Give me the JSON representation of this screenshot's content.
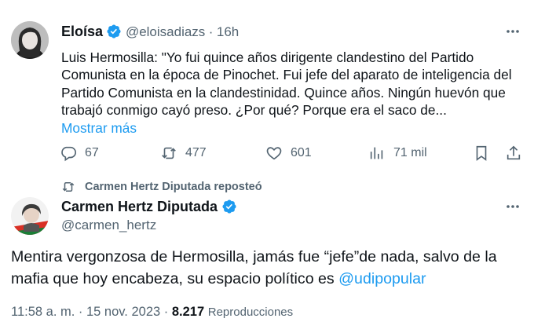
{
  "original_tweet": {
    "author_name": "Eloísa",
    "author_handle": "@eloisadiazs",
    "separator": "·",
    "time_ago": "16h",
    "text_lines": [
      "Luis Hermosilla: \"Yo fui quince años dirigente clandestino del Partido",
      "Comunista en la época de Pinochet. Fui jefe del aparato de inteligencia del",
      "Partido Comunista en la clandestinidad. Quince años. Ningún huevón que",
      "trabajó conmigo cayó preso. ¿Por qué? Porque era el saco de..."
    ],
    "show_more": "Mostrar más",
    "stats": {
      "replies": "67",
      "reposts": "477",
      "likes": "601",
      "views": "71 mil"
    },
    "icons": [
      "reply-icon",
      "repost-icon",
      "like-icon",
      "views-icon",
      "bookmark-icon",
      "share-icon",
      "more-icon",
      "verified-icon"
    ]
  },
  "repost_banner": {
    "text": "Carmen Hertz Diputada reposteó"
  },
  "main_tweet": {
    "author_name": "Carmen Hertz Diputada",
    "author_handle": "@carmen_hertz",
    "text_lines": [
      "Mentira vergonzosa de Hermosilla, jamás fue “jefe”de nada, salvo de la",
      "mafia que hoy encabeza, su espacio político es "
    ],
    "mention": "@udipopular",
    "timestamp": "11:58 a. m. · 15 nov. 2023 ·",
    "views_count": "8.217",
    "views_label": "Reproducciones"
  },
  "colors": {
    "accent": "#1d9bf0",
    "secondary_text": "#536471",
    "primary_text": "#0f1419"
  }
}
